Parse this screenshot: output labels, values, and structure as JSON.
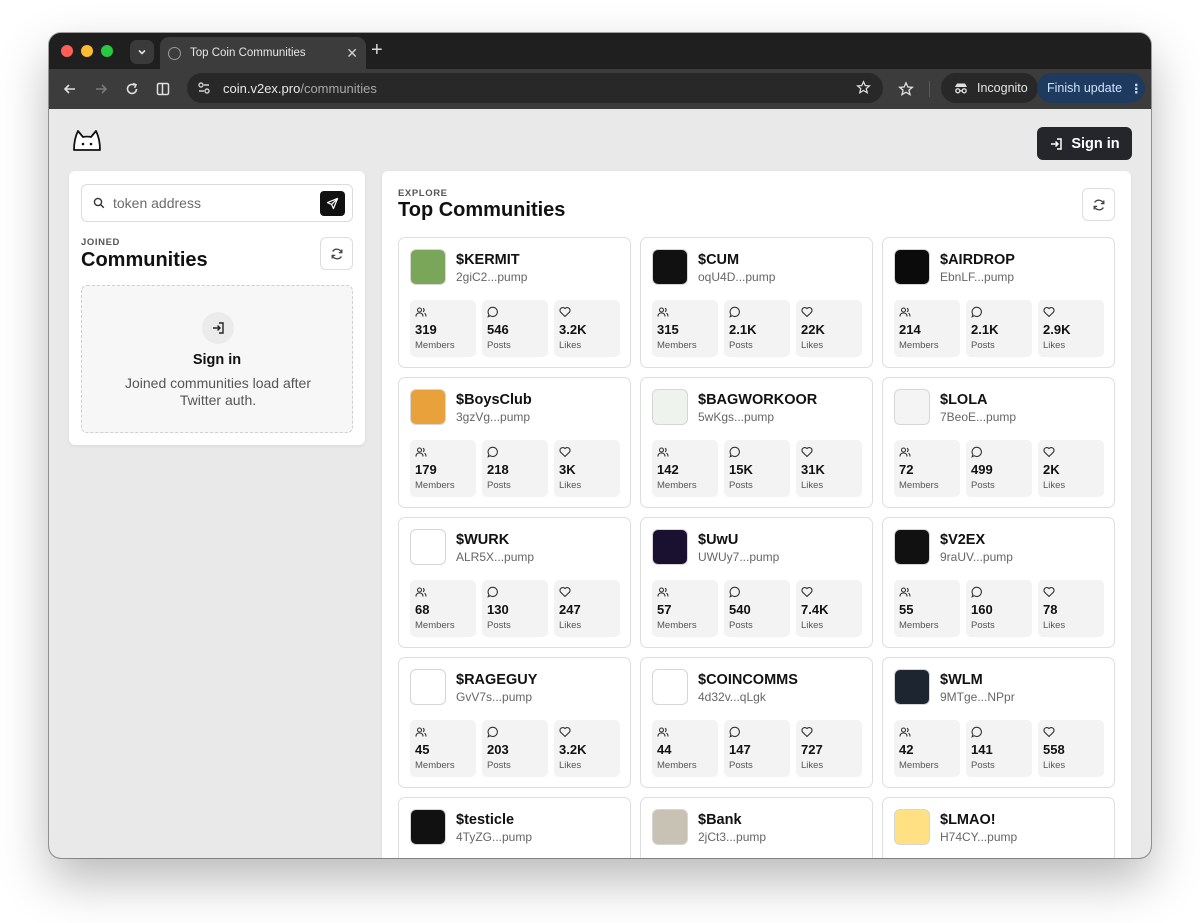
{
  "browser": {
    "tab_title": "Top Coin Communities",
    "url_host": "coin.v2ex.pro",
    "url_path": "/communities",
    "incognito_label": "Incognito",
    "update_label": "Finish update"
  },
  "header": {
    "signin_label": "Sign in"
  },
  "sidebar": {
    "search_placeholder": "token address",
    "eyebrow": "JOINED",
    "title": "Communities",
    "empty_title": "Sign in",
    "empty_text": "Joined communities load after Twitter auth."
  },
  "main": {
    "eyebrow": "EXPLORE",
    "title": "Top Communities"
  },
  "stat_labels": {
    "members": "Members",
    "posts": "Posts",
    "likes": "Likes"
  },
  "communities": [
    {
      "name": "$KERMIT",
      "address": "2giC2...pump",
      "members": "319",
      "posts": "546",
      "likes": "3.2K",
      "avatar_bg": "#7aa65a",
      "avatar_icon": "frog-icon"
    },
    {
      "name": "$CUM",
      "address": "oqU4D...pump",
      "members": "315",
      "posts": "2.1K",
      "likes": "22K",
      "avatar_bg": "#111111",
      "avatar_icon": "pattern-icon"
    },
    {
      "name": "$AIRDROP",
      "address": "EbnLF...pump",
      "members": "214",
      "posts": "2.1K",
      "likes": "2.9K",
      "avatar_bg": "#0b0b0b",
      "avatar_icon": "airdrop-text-icon"
    },
    {
      "name": "$BoysClub",
      "address": "3gzVg...pump",
      "members": "179",
      "posts": "218",
      "likes": "3K",
      "avatar_bg": "#e9a23b",
      "avatar_icon": "characters-icon"
    },
    {
      "name": "$BAGWORKOOR",
      "address": "5wKgs...pump",
      "members": "142",
      "posts": "15K",
      "likes": "31K",
      "avatar_bg": "#eef3ee",
      "avatar_icon": "pepe-icon"
    },
    {
      "name": "$LOLA",
      "address": "7BeoE...pump",
      "members": "72",
      "posts": "499",
      "likes": "2K",
      "avatar_bg": "#f4f4f4",
      "avatar_icon": "girl-icon"
    },
    {
      "name": "$WURK",
      "address": "ALR5X...pump",
      "members": "68",
      "posts": "130",
      "likes": "247",
      "avatar_bg": "#ffffff",
      "avatar_icon": "wurk-logo-icon"
    },
    {
      "name": "$UwU",
      "address": "UWUy7...pump",
      "members": "57",
      "posts": "540",
      "likes": "7.4K",
      "avatar_bg": "#1a1030",
      "avatar_icon": "unicorn-icon"
    },
    {
      "name": "$V2EX",
      "address": "9raUV...pump",
      "members": "55",
      "posts": "160",
      "likes": "78",
      "avatar_bg": "#111111",
      "avatar_icon": "v2ex-logo-icon"
    },
    {
      "name": "$RAGEGUY",
      "address": "GvV7s...pump",
      "members": "45",
      "posts": "203",
      "likes": "3.2K",
      "avatar_bg": "#ffffff",
      "avatar_icon": "rage-face-icon"
    },
    {
      "name": "$COINCOMMS",
      "address": "4d32v...qLgk",
      "members": "44",
      "posts": "147",
      "likes": "727",
      "avatar_bg": "#ffffff",
      "avatar_icon": "coincomms-logo-icon"
    },
    {
      "name": "$WLM",
      "address": "9MTge...NPpr",
      "members": "42",
      "posts": "141",
      "likes": "558",
      "avatar_bg": "#1c2530",
      "avatar_icon": "hand-icon"
    },
    {
      "name": "$testicle",
      "address": "4TyZG...pump",
      "members": "",
      "posts": "",
      "likes": "",
      "avatar_bg": "#111111",
      "avatar_icon": "yellow-blob-icon"
    },
    {
      "name": "$Bank",
      "address": "2jCt3...pump",
      "members": "",
      "posts": "",
      "likes": "",
      "avatar_bg": "#c8c2b4",
      "avatar_icon": "bank-building-icon"
    },
    {
      "name": "$LMAO!",
      "address": "H74CY...pump",
      "members": "",
      "posts": "",
      "likes": "",
      "avatar_bg": "#ffe082",
      "avatar_icon": "laughing-emoji-icon"
    }
  ]
}
